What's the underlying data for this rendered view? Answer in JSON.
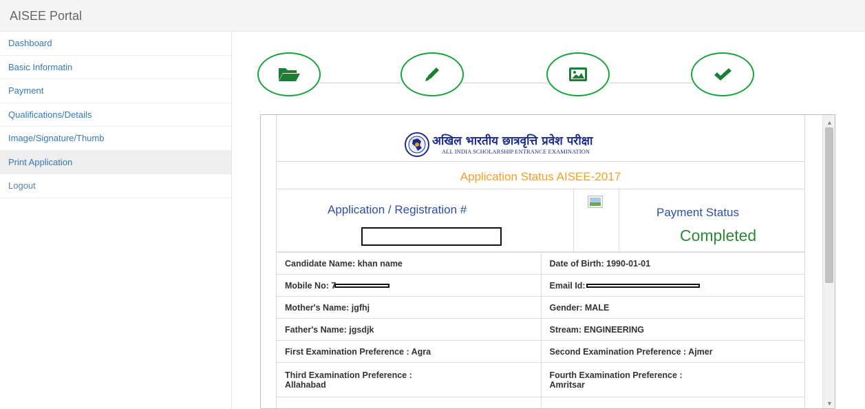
{
  "app": {
    "title": "AISEE Portal"
  },
  "sidebar": {
    "items": [
      {
        "label": "Dashboard"
      },
      {
        "label": "Basic Informatin"
      },
      {
        "label": "Payment"
      },
      {
        "label": "Qualifications/Details"
      },
      {
        "label": "Image/Signature/Thumb"
      },
      {
        "label": "Print Application"
      },
      {
        "label": "Logout"
      }
    ],
    "active_index": 5
  },
  "steps": {
    "icons": [
      "folder-open-icon",
      "pencil-icon",
      "picture-icon",
      "checkmark-icon"
    ],
    "color": "#16a33b"
  },
  "document": {
    "hindi_title": "अखिल भारतीय छात्रवृत्ति प्रवेश परीक्षा",
    "english_title": "ALL INDIA SCHOLARSHIP ENTRANCE EXAMINATION",
    "status_title": "Application Status AISEE-2017",
    "registration_label": "Application / Registration #",
    "payment_label": "Payment Status",
    "payment_status": "Completed"
  },
  "details": {
    "candidate_name": "Candidate Name: khan name",
    "dob": "Date of Birth: 1990-01-01",
    "mobile_label": "Mobile No: 7",
    "email_label": "Email Id: ",
    "mother_name": "Mother's Name: jgfhj",
    "gender": "Gender: MALE",
    "father_name": "Father's Name: jgsdjk",
    "stream": "Stream: ENGINEERING",
    "first_pref": "First Examination Preference : Agra",
    "second_pref": "Second Examination Preference : Ajmer",
    "third_pref_label": "Third Examination Preference :",
    "third_pref_value": "Allahabad",
    "fourth_pref_label": "Fourth Examination Preference :",
    "fourth_pref_value": "Amritsar"
  },
  "colors": {
    "accent_green": "#16a33b",
    "link_blue": "#337ab7",
    "status_orange": "#f0a028",
    "heading_blue": "#2c4ea3",
    "completed_green": "#2b8a34"
  }
}
